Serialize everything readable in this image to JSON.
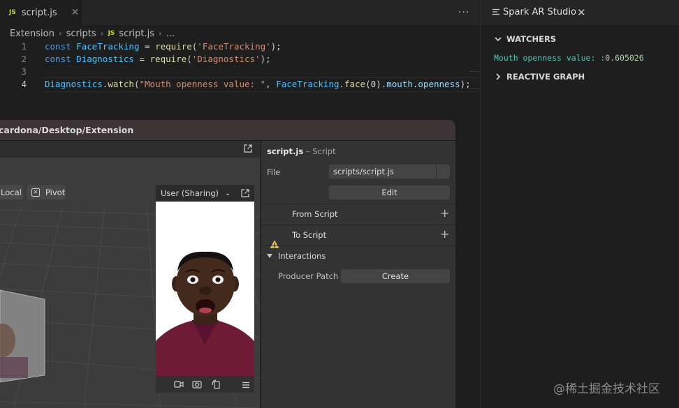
{
  "editor": {
    "tab": {
      "badge": "JS",
      "name": "script.js",
      "close": "✕"
    },
    "more": "···",
    "breadcrumb": {
      "part1": "Extension",
      "part2": "scripts",
      "badge": "JS",
      "file": "script.js",
      "tail": "..."
    },
    "lines": [
      {
        "num": "1",
        "t1": "const",
        "t2": " FaceTracking",
        "t3": " = ",
        "t4": "require",
        "t5": "(",
        "t6": "'FaceTracking'",
        "t7": ");"
      },
      {
        "num": "2",
        "t1": "const",
        "t2": " Diagnostics",
        "t3": " = ",
        "t4": "require",
        "t5": "(",
        "t6": "'Diagnostics'",
        "t7": ");"
      },
      {
        "num": "3"
      },
      {
        "num": "4",
        "t1": "Diagnostics",
        "t2": ".",
        "t3": "watch",
        "t4": "(",
        "t5": "\"Mouth openness value: \"",
        "t6": ", ",
        "t7": "FaceTracking",
        "t8": ".",
        "t9": "face",
        "t10": "(0).",
        "t11": "mouth",
        "t12": ".",
        "t13": "openness",
        "t14": ");"
      }
    ]
  },
  "spark": {
    "title": "cardona/Desktop/Extension",
    "viewport": {
      "local_label": "Local",
      "pivot_label": "Pivot",
      "pivot_icon": "✕"
    },
    "simulator": {
      "device_label": "User (Sharing)",
      "chevron": "⌄"
    },
    "inspector": {
      "title": "script.js",
      "subtitle": " – Script",
      "file_label": "File",
      "file_value": "scripts/script.js",
      "edit_label": "Edit",
      "from_script": "From Script",
      "to_script": "To Script",
      "add_symbol": "+",
      "interactions": "Interactions",
      "producer_patch": "Producer Patch",
      "create_label": "Create"
    }
  },
  "panel": {
    "title": "Spark AR Studio",
    "close": "✕",
    "watchers_label": "WATCHERS",
    "watch_key": "Mouth openness value: :",
    "watch_value": "0.605026",
    "reactive_label": "REACTIVE GRAPH"
  },
  "watermark": "@稀土掘金技术社区",
  "colors": {
    "keyword": "#569cd6",
    "variable": "#4fc1ff",
    "function": "#dcdcaa",
    "string": "#ce9178",
    "property": "#9cdcfe",
    "js_badge": "#cbcb41",
    "watch_key": "#4ec9b0",
    "watch_value": "#b5cea8"
  }
}
